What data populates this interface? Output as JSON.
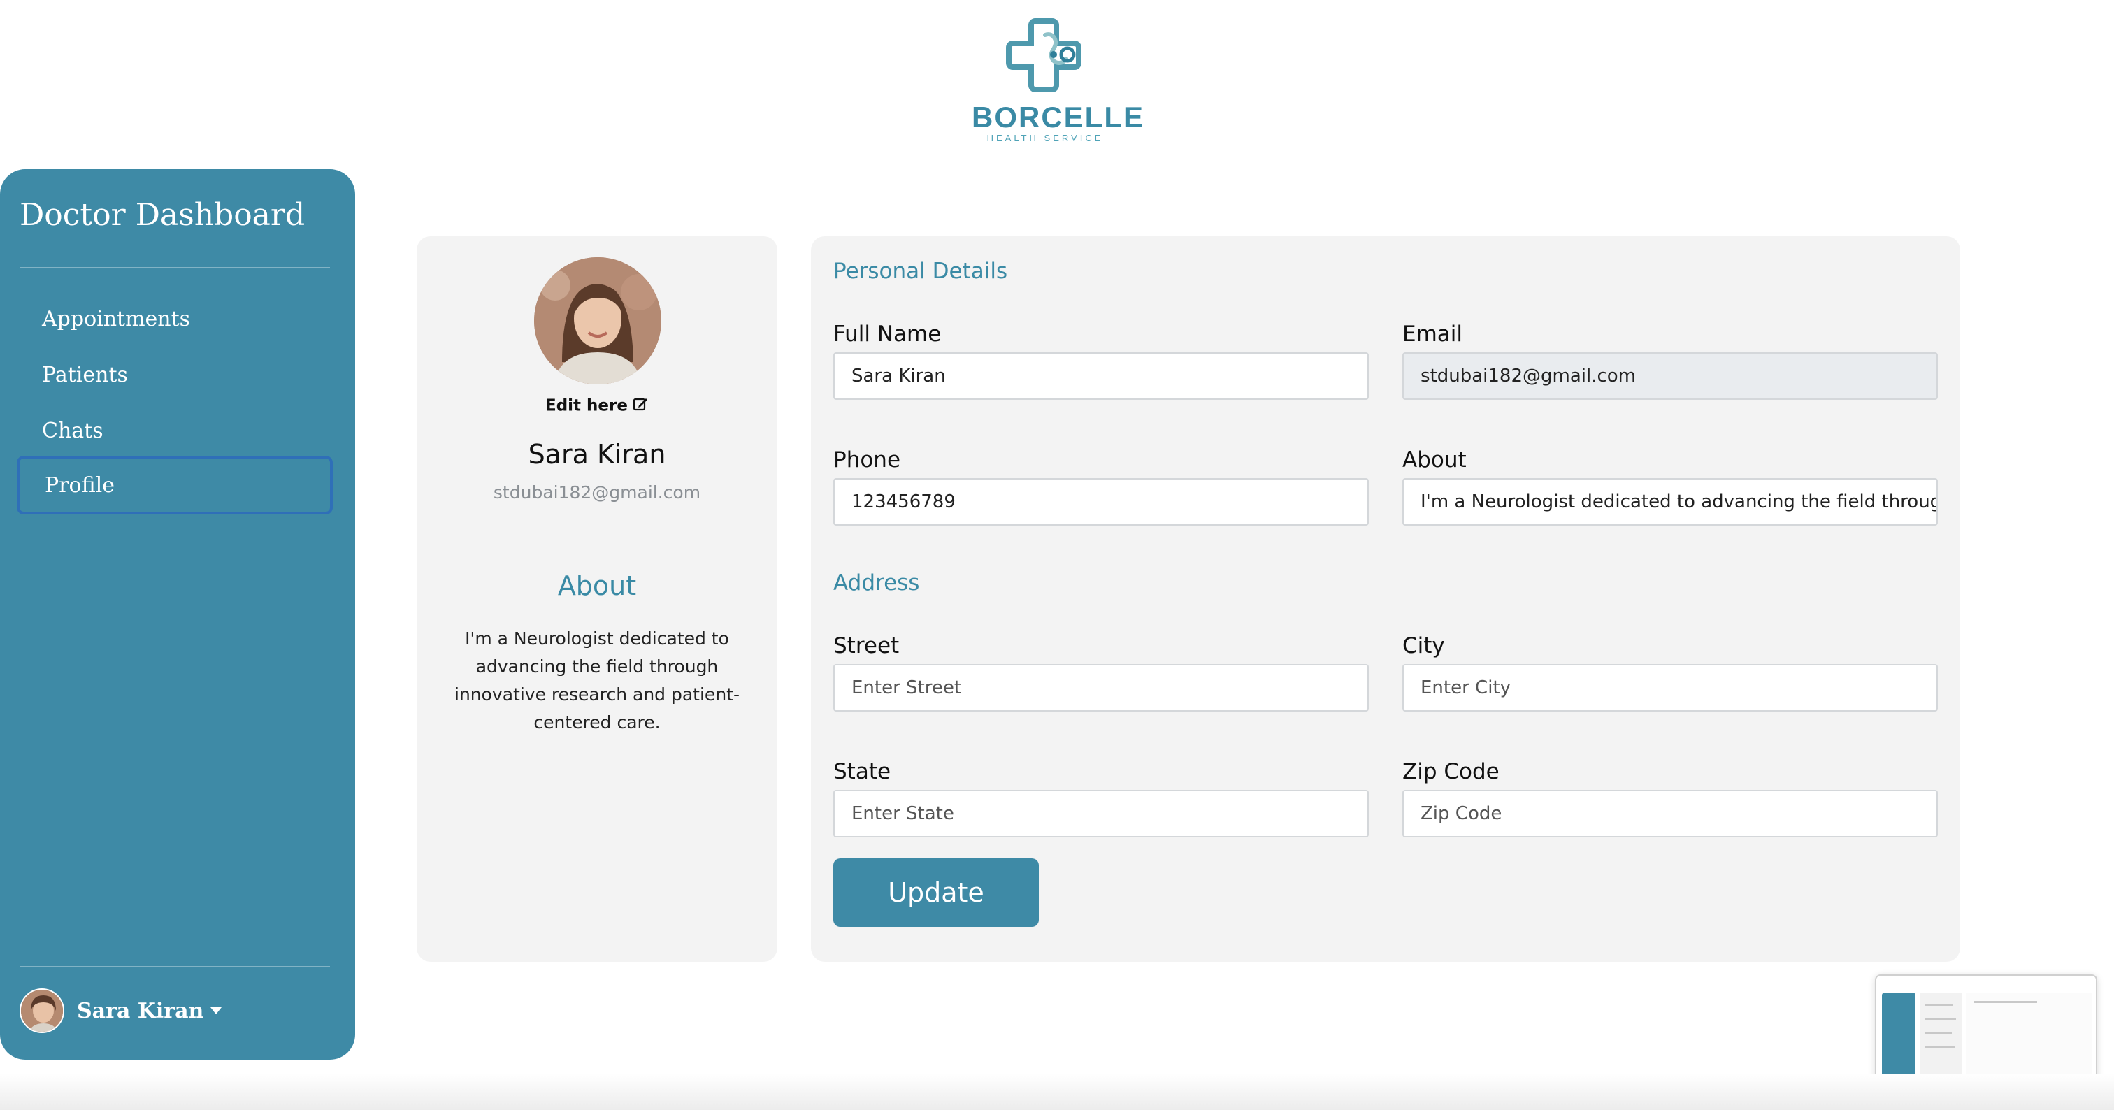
{
  "brand": {
    "name": "BORCELLE",
    "tagline": "HEALTH SERVICE",
    "color": "#3a8aa5"
  },
  "sidebar": {
    "title": "Doctor Dashboard",
    "items": [
      {
        "label": "Appointments"
      },
      {
        "label": "Patients"
      },
      {
        "label": "Chats"
      },
      {
        "label": "Profile",
        "active": true
      }
    ],
    "user": {
      "name": "Sara Kiran"
    },
    "color": "#3e8aa6"
  },
  "profile": {
    "edit_label": "Edit here",
    "name": "Sara Kiran",
    "email": "stdubai182@gmail.com",
    "about_heading": "About",
    "about_text": "I'm a Neurologist dedicated to advancing the field through innovative research and patient-centered care."
  },
  "details": {
    "personal_heading": "Personal Details",
    "full_name": {
      "label": "Full Name",
      "value": "Sara Kiran"
    },
    "email": {
      "label": "Email",
      "value": "stdubai182@gmail.com"
    },
    "phone": {
      "label": "Phone",
      "value": "123456789"
    },
    "about": {
      "label": "About",
      "value": "I'm a Neurologist dedicated to advancing the field through"
    },
    "address_heading": "Address",
    "street": {
      "label": "Street",
      "placeholder": "Enter Street"
    },
    "city": {
      "label": "City",
      "placeholder": "Enter City"
    },
    "state": {
      "label": "State",
      "placeholder": "Enter State"
    },
    "zip": {
      "label": "Zip Code",
      "placeholder": "Zip Code"
    },
    "update_label": "Update"
  }
}
